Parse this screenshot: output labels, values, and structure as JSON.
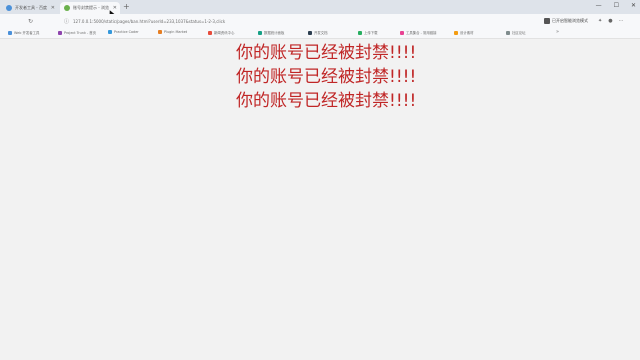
{
  "browser": {
    "tabs": [
      {
        "label": "开发者工具 - 百度",
        "fav_color": "#4a90d9"
      },
      {
        "label": "账号封禁提示 - 浏览",
        "fav_color": "#6ab04c"
      }
    ],
    "new_tab_symbol": "+",
    "address": "127.0.0.1:5000/static/pages/ban.html?userId=233,1037&status=1-2-3,click",
    "right_label": "已开启智能浏览模式",
    "bookmarks": [
      {
        "label": "Web 开发者工具",
        "color": "#4a90d9"
      },
      {
        "label": "Project Trunk - 首页",
        "color": "#8e44ad"
      },
      {
        "label": "Practice Coder",
        "color": "#3498db"
      },
      {
        "label": "Plugin Market",
        "color": "#e67e22"
      },
      {
        "label": "新闻资讯中心",
        "color": "#e74c3c"
      },
      {
        "label": "数据统计面板",
        "color": "#16a085"
      },
      {
        "label": "开发文档",
        "color": "#2c3e50"
      },
      {
        "label": "上传下载",
        "color": "#27ae60"
      },
      {
        "label": "工具集合 - 常用链接",
        "color": "#e84393"
      },
      {
        "label": "设计素材",
        "color": "#f39c12"
      },
      {
        "label": "社区论坛",
        "color": "#7f8c8d"
      }
    ]
  },
  "page": {
    "messages": [
      "你的账号已经被封禁!!!!",
      "你的账号已经被封禁!!!!",
      "你的账号已经被封禁!!!!"
    ]
  },
  "colors": {
    "message": "#c02626",
    "background": "#f2f2f2"
  }
}
